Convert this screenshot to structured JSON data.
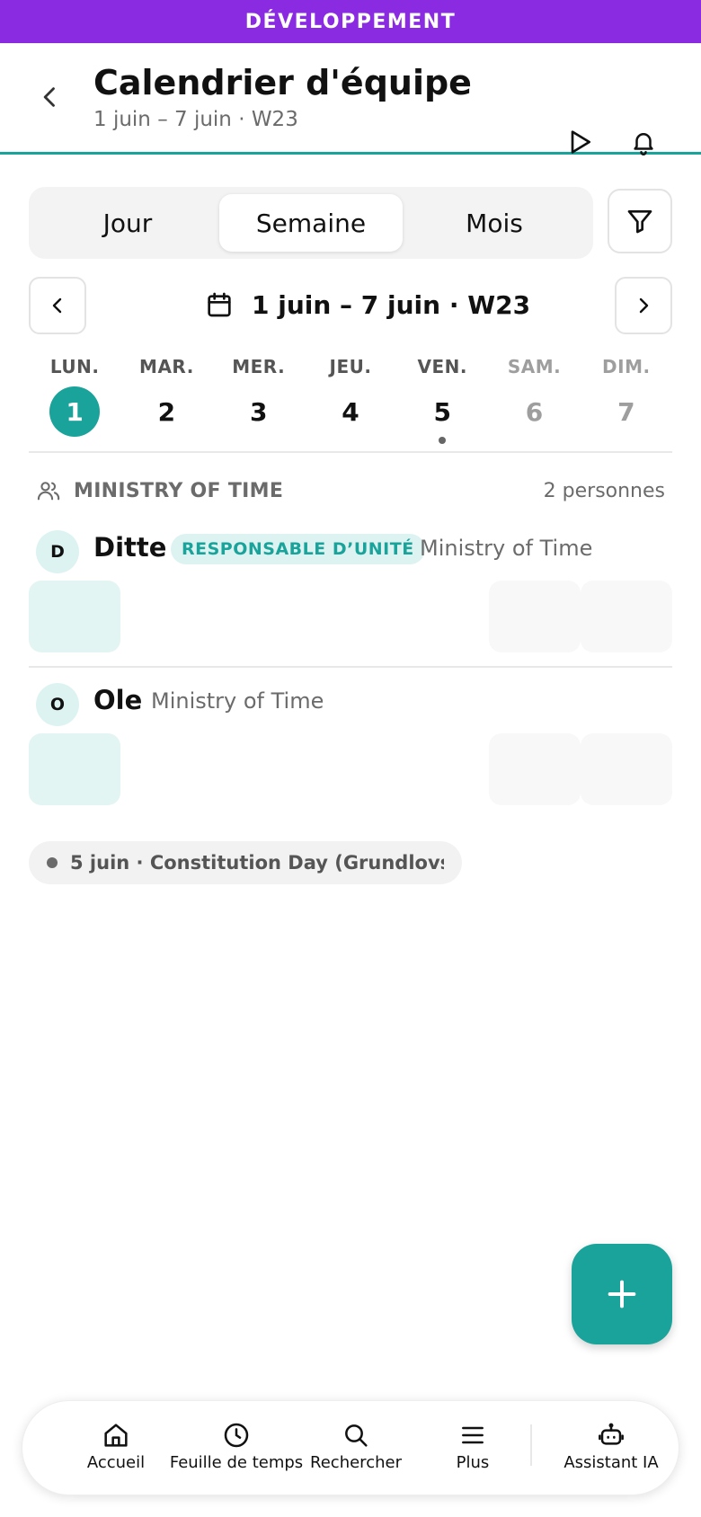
{
  "banner": {
    "label": "DÉVELOPPEMENT"
  },
  "header": {
    "title": "Calendrier d'équipe",
    "subtitle": "1 juin – 7 juin · W23"
  },
  "view_switch": {
    "options": [
      "Jour",
      "Semaine",
      "Mois"
    ],
    "selected": "Semaine"
  },
  "range": {
    "label": "1 juin – 7 juin · W23"
  },
  "days": [
    {
      "name": "LUN.",
      "num": "1",
      "selected": true
    },
    {
      "name": "MAR.",
      "num": "2"
    },
    {
      "name": "MER.",
      "num": "3"
    },
    {
      "name": "JEU.",
      "num": "4"
    },
    {
      "name": "VEN.",
      "num": "5",
      "event_dot": true
    },
    {
      "name": "SAM.",
      "num": "6",
      "weekend": true
    },
    {
      "name": "DIM.",
      "num": "7",
      "weekend": true
    }
  ],
  "group": {
    "name": "MINISTRY OF TIME",
    "count": "2 personnes"
  },
  "people": [
    {
      "initial": "D",
      "name": "Ditte",
      "badge": "RESPONSABLE D’UNITÉ",
      "org": "Ministry of Time"
    },
    {
      "initial": "O",
      "name": "Ole",
      "org": "Ministry of Time"
    }
  ],
  "holiday": {
    "label": "5 juin · Constitution Day (Grundlovs..."
  },
  "bottom_nav": {
    "home": "Accueil",
    "timesheet": "Feuille de temps",
    "search": "Rechercher",
    "more": "Plus",
    "assistant": "Assistant IA"
  },
  "colors": {
    "accent": "#1aa39a",
    "banner": "#8a2be2",
    "muted": "#6b6b6b"
  }
}
